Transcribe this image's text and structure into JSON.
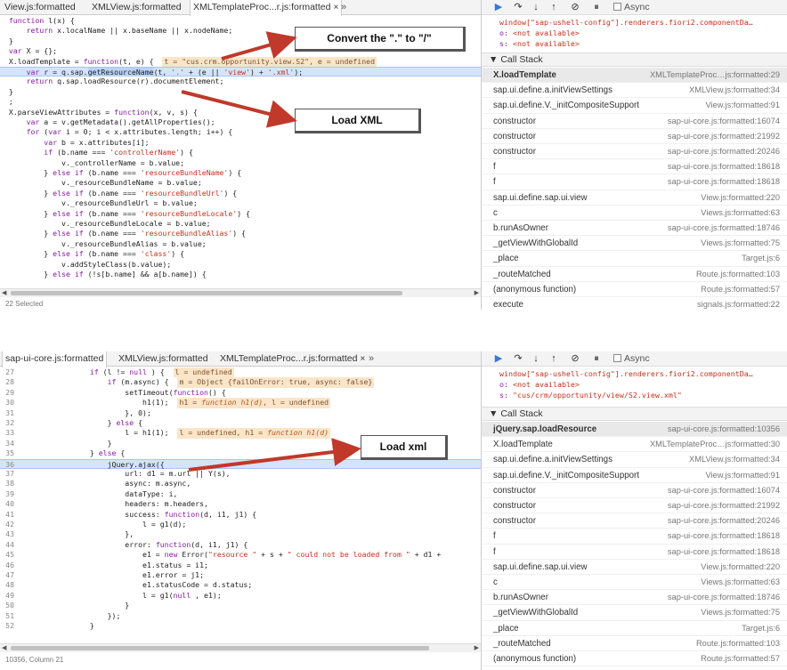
{
  "top": {
    "tabs": [
      "View.js:formatted",
      "XMLView.js:formatted",
      "XMLTemplateProc...r.js:formatted"
    ],
    "close": "×",
    "more": "»",
    "code_lines": [
      "function l(x) {",
      "    return x.localName || x.baseName || x.nodeName;",
      "}",
      "var X = {};",
      "X.loadTemplate = function(t, e) {",
      "    var r = q.sap.getResourceName(t, '.' + (e || 'view') + '.xml');",
      "    return q.sap.loadResource(r).documentElement;",
      "}",
      ";",
      "X.parseViewAttributes = function(x, v, s) {",
      "    var a = v.getMetadata().getAllProperties();",
      "    for (var i = 0; i < x.attributes.length; i++) {",
      "        var b = x.attributes[i];",
      "        if (b.name === 'controllerName') {",
      "            v._controllerName = b.value;",
      "        } else if (b.name === 'resourceBundleName') {",
      "            v._resourceBundleName = b.value;",
      "        } else if (b.name === 'resourceBundleUrl') {",
      "            v._resourceBundleUrl = b.value;",
      "        } else if (b.name === 'resourceBundleLocale') {",
      "            v._resourceBundleLocale = b.value;",
      "        } else if (b.name === 'resourceBundleAlias') {",
      "            v._resourceBundleAlias = b.value;",
      "        } else if (b.name === 'class') {",
      "            v.addStyleClass(b.value);",
      "        } else if (!s[b.name] && a[b.name]) {"
    ],
    "inline_annotation": "t = \"cus.crm.opportunity.view.S2\", e = undefined",
    "scope": {
      "window": "window[\"sap-ushell-config\"].renderers.fiori2.componentDa…",
      "o_key": "o:",
      "o_val": "<not available>",
      "s_key": "s:",
      "s_val": "<not available>"
    },
    "call_stack_title": "Call Stack",
    "async_label": "Async",
    "frames": [
      {
        "name": "X.loadTemplate",
        "loc": "XMLTemplateProc…js:formatted:29"
      },
      {
        "name": "sap.ui.define.a.initViewSettings",
        "loc": "XMLView.js:formatted:34"
      },
      {
        "name": "sap.ui.define.V._initCompositeSupport",
        "loc": "View.js:formatted:91"
      },
      {
        "name": "constructor",
        "loc": "sap-ui-core.js:formatted:16074"
      },
      {
        "name": "constructor",
        "loc": "sap-ui-core.js:formatted:21992"
      },
      {
        "name": "constructor",
        "loc": "sap-ui-core.js:formatted:20246"
      },
      {
        "name": "f",
        "loc": "sap-ui-core.js:formatted:18618"
      },
      {
        "name": "f",
        "loc": "sap-ui-core.js:formatted:18618"
      },
      {
        "name": "sap.ui.define.sap.ui.view",
        "loc": "View.js:formatted:220"
      },
      {
        "name": "c",
        "loc": "Views.js:formatted:63"
      },
      {
        "name": "b.runAsOwner",
        "loc": "sap-ui-core.js:formatted:18746"
      },
      {
        "name": "_getViewWithGlobalId",
        "loc": "Views.js:formatted:75"
      },
      {
        "name": "_place",
        "loc": "Target.js:6"
      },
      {
        "name": "_routeMatched",
        "loc": "Route.js:formatted:103"
      },
      {
        "name": "(anonymous function)",
        "loc": "Route.js:formatted:57"
      },
      {
        "name": "execute",
        "loc": "signals.js:formatted:22"
      }
    ],
    "callouts": [
      "Convert the \".\" to \"/\"",
      "Load XML"
    ],
    "status": "22  Selected"
  },
  "bottom": {
    "tabs": [
      "sap-ui-core.js:formatted",
      "XMLView.js:formatted",
      "XMLTemplateProc...r.js:formatted"
    ],
    "close": "×",
    "more": "»",
    "code_lines": [
      {
        "n": "27",
        "t": "                if (l != null ) {  "
      },
      {
        "n": "28",
        "t": "                    if (m.async) {  "
      },
      {
        "n": "29",
        "t": "                        setTimeout(function() {"
      },
      {
        "n": "30",
        "t": "                            h1(1);  "
      },
      {
        "n": "31",
        "t": "                        }, 0);"
      },
      {
        "n": "32",
        "t": "                    } else {"
      },
      {
        "n": "33",
        "t": "                        l = h1(1);  "
      },
      {
        "n": "34",
        "t": "                    }"
      },
      {
        "n": "35",
        "t": "                } else {"
      },
      {
        "n": "36",
        "t": "                    jQuery.ajax({"
      },
      {
        "n": "37",
        "t": "                        url: d1 = m.url || Y(s),"
      },
      {
        "n": "38",
        "t": "                        async: m.async,"
      },
      {
        "n": "39",
        "t": "                        dataType: i,"
      },
      {
        "n": "40",
        "t": "                        headers: m.headers,"
      },
      {
        "n": "41",
        "t": "                        success: function(d, i1, j1) {"
      },
      {
        "n": "42",
        "t": "                            l = g1(d);"
      },
      {
        "n": "43",
        "t": "                        },"
      },
      {
        "n": "44",
        "t": "                        error: function(d, i1, j1) {"
      },
      {
        "n": "45",
        "t": "                            e1 = new Error(\"resource \" + s + \" could not be loaded from \" + d1 +"
      },
      {
        "n": "46",
        "t": "                            e1.status = i1;"
      },
      {
        "n": "47",
        "t": "                            e1.error = j1;"
      },
      {
        "n": "48",
        "t": "                            e1.statusCode = d.status;"
      },
      {
        "n": "49",
        "t": "                            l = g1(null , e1);"
      },
      {
        "n": "50",
        "t": "                        }"
      },
      {
        "n": "51",
        "t": "                    });"
      },
      {
        "n": "52",
        "t": "                }"
      }
    ],
    "annotations": {
      "a27": "l = undefined",
      "a28": "m = Object {failOnError: true, async: false}",
      "a30_pre": "h1 = ",
      "a30_fn": "function h1(d)",
      "a30_post": ", l = undefined",
      "a33_pre": "l = undefined, h1 = ",
      "a33_fn": "function h1(d)"
    },
    "scope": {
      "window": "window[\"sap-ushell-config\"].renderers.fiori2.componentDa…",
      "o_key": "o:",
      "o_val": "<not available>",
      "s_key": "s:",
      "s_val": "\"cus/crm/opportunity/view/S2.view.xml\""
    },
    "call_stack_title": "Call Stack",
    "async_label": "Async",
    "frames": [
      {
        "name": "jQuery.sap.loadResource",
        "loc": "sap-ui-core.js:formatted:10356"
      },
      {
        "name": "X.loadTemplate",
        "loc": "XMLTemplateProc…js:formatted:30"
      },
      {
        "name": "sap.ui.define.a.initViewSettings",
        "loc": "XMLView.js:formatted:34"
      },
      {
        "name": "sap.ui.define.V._initCompositeSupport",
        "loc": "View.js:formatted:91"
      },
      {
        "name": "constructor",
        "loc": "sap-ui-core.js:formatted:16074"
      },
      {
        "name": "constructor",
        "loc": "sap-ui-core.js:formatted:21992"
      },
      {
        "name": "constructor",
        "loc": "sap-ui-core.js:formatted:20246"
      },
      {
        "name": "f",
        "loc": "sap-ui-core.js:formatted:18618"
      },
      {
        "name": "f",
        "loc": "sap-ui-core.js:formatted:18618"
      },
      {
        "name": "sap.ui.define.sap.ui.view",
        "loc": "View.js:formatted:220"
      },
      {
        "name": "c",
        "loc": "Views.js:formatted:63"
      },
      {
        "name": "b.runAsOwner",
        "loc": "sap-ui-core.js:formatted:18746"
      },
      {
        "name": "_getViewWithGlobalId",
        "loc": "Views.js:formatted:75"
      },
      {
        "name": "_place",
        "loc": "Target.js:6"
      },
      {
        "name": "_routeMatched",
        "loc": "Route.js:formatted:103"
      },
      {
        "name": "(anonymous function)",
        "loc": "Route.js:formatted:57"
      }
    ],
    "callouts": [
      "Load xml"
    ],
    "status": "10356, Column 21"
  },
  "icons": [
    "resume-icon",
    "step-over-icon",
    "step-into-icon",
    "step-out-icon",
    "deactivate-breakpoints-icon",
    "pause-on-exceptions-icon"
  ],
  "colors": {
    "highlight": "#d4e4fb",
    "annotation": "#fbe5c8",
    "arrow": "#c0392b"
  }
}
